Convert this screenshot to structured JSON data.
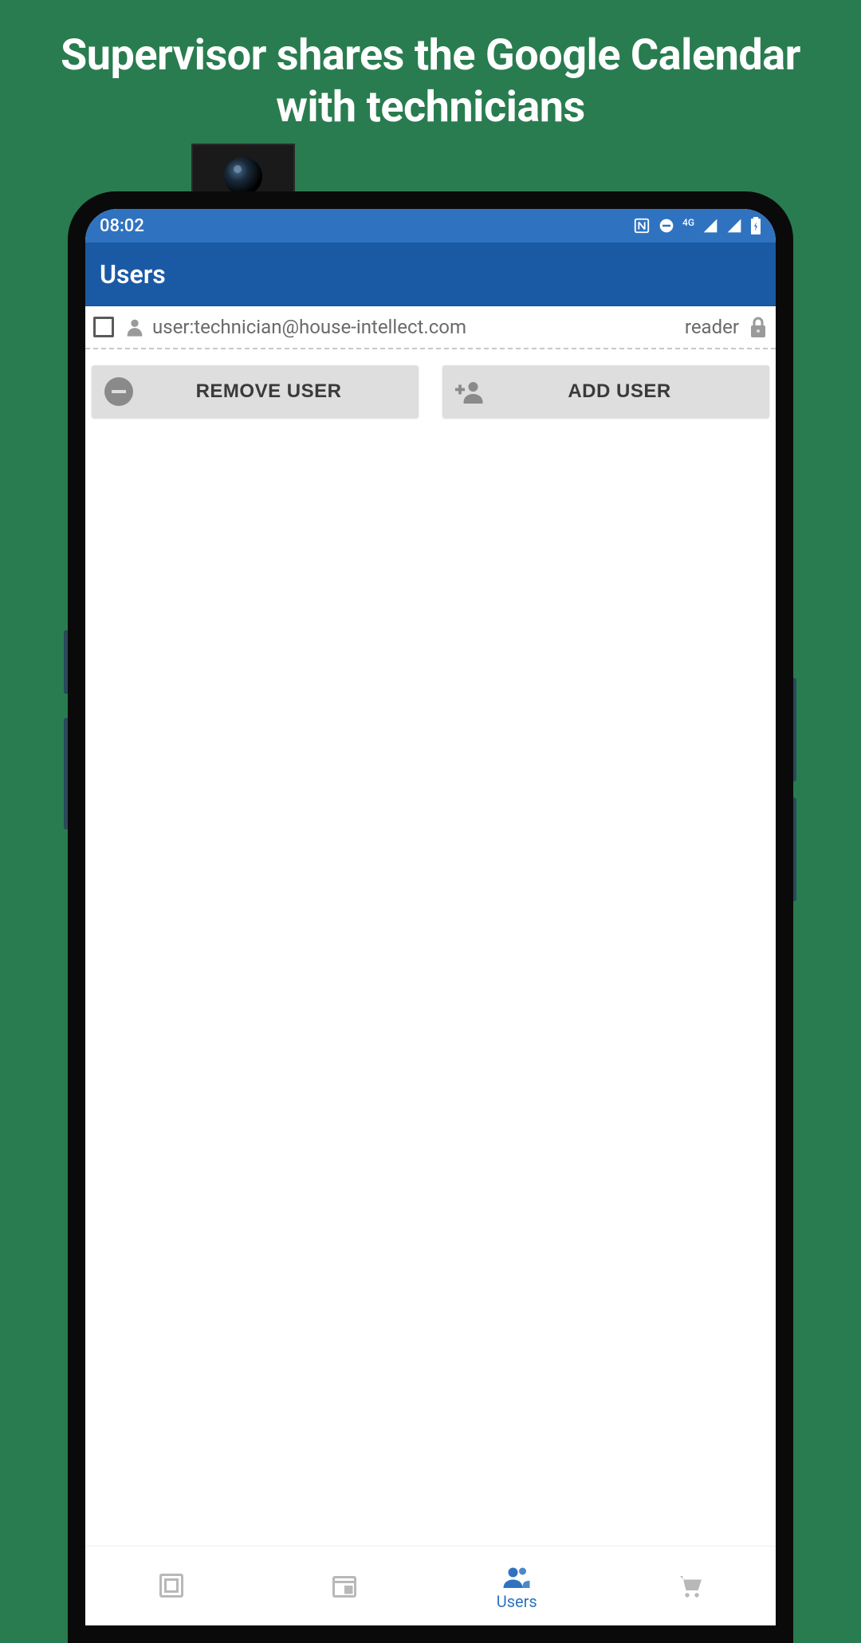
{
  "promo": {
    "title": "Supervisor shares the Google Calendar with technicians"
  },
  "status_bar": {
    "time": "08:02",
    "network_label": "4G"
  },
  "app_bar": {
    "title": "Users"
  },
  "user_row": {
    "email": "user:technician@house-intellect.com",
    "role": "reader"
  },
  "buttons": {
    "remove": "REMOVE USER",
    "add": "ADD USER"
  },
  "bottom_nav": {
    "items": [
      {
        "name": "overview",
        "label": ""
      },
      {
        "name": "calendar",
        "label": ""
      },
      {
        "name": "users",
        "label": "Users"
      },
      {
        "name": "shop",
        "label": ""
      }
    ],
    "active_index": 2
  },
  "colors": {
    "background": "#297c4f",
    "primary": "#1a5aa5",
    "status_bar": "#2f73c0"
  }
}
